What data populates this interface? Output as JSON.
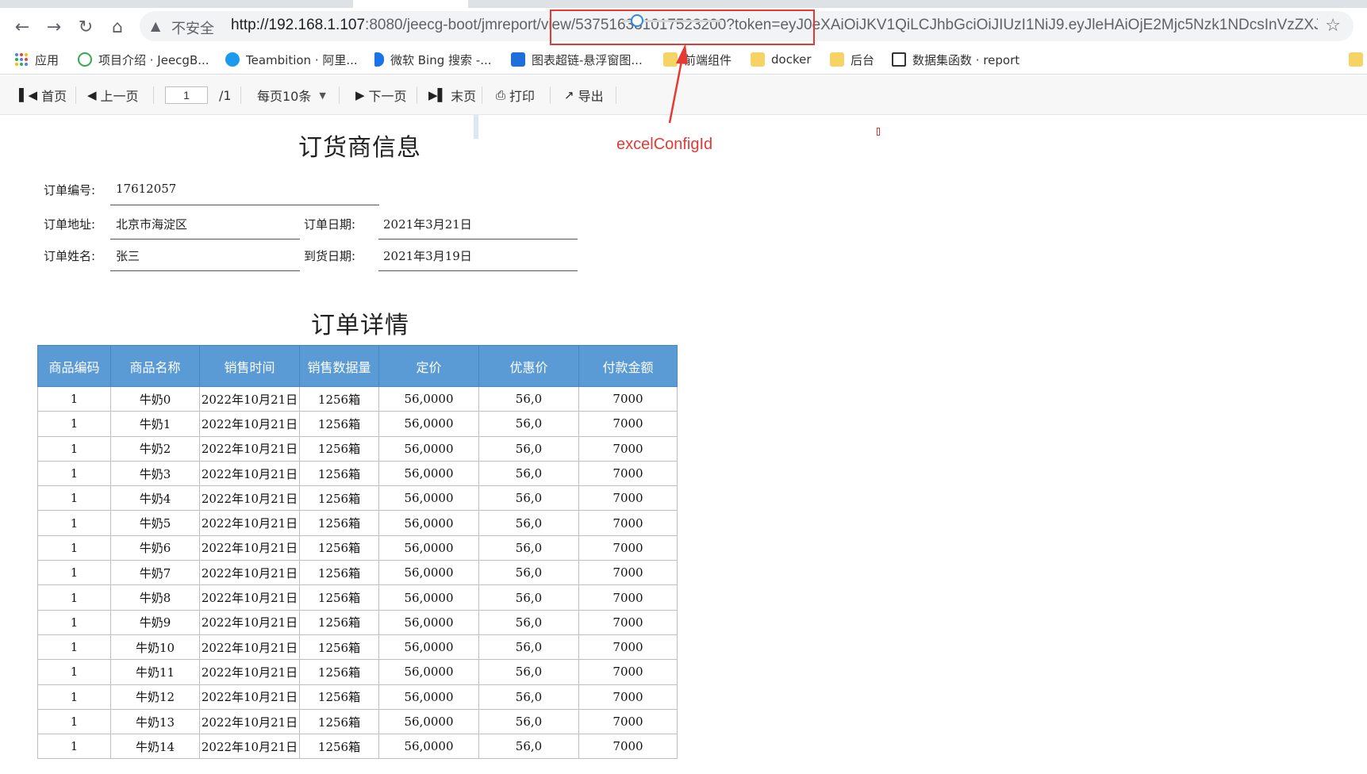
{
  "browser": {
    "insecure_label": "不安全",
    "url_host": "http://192.168.1.107",
    "url_rest": ":8080/jeecg-boot/jmreport/view/537516331017523200?token=eyJ0eXAiOiJKV1QiLCJhbGciOiJIUzI1NiJ9.eyJleHAiOjE2Mjc5Nzk1NDcsInVzZXJ...",
    "bookmarks": [
      {
        "label": "应用",
        "icon": "apps-grid-icon"
      },
      {
        "label": "项目介绍 · JeecgB...",
        "icon": "jeecg-icon"
      },
      {
        "label": "Teambition · 阿里...",
        "icon": "teambition-icon"
      },
      {
        "label": "微软 Bing 搜索 -...",
        "icon": "bing-icon"
      },
      {
        "label": "图表超链-悬浮窗图...",
        "icon": "fanruan-icon"
      },
      {
        "label": "前端组件",
        "icon": "folder-icon"
      },
      {
        "label": "docker",
        "icon": "folder-icon"
      },
      {
        "label": "后台",
        "icon": "folder-icon"
      },
      {
        "label": "数据集函数 · report",
        "icon": "book-icon"
      }
    ]
  },
  "toolbar": {
    "first": "首页",
    "prev": "上一页",
    "page_value": "1",
    "page_total": "/1",
    "page_size": "每页10条",
    "next": "下一页",
    "last": "末页",
    "print": "打印",
    "export": "导出",
    "zoom": 0.1
  },
  "annotation": {
    "label": "excelConfigId",
    "color": "#e53935"
  },
  "report": {
    "supplier_title": "订货商信息",
    "order_no_label": "订单编号:",
    "order_no": "17612057",
    "address_label": "订单地址:",
    "address": "北京市海淀区",
    "order_date_label": "订单日期:",
    "order_date": "2021年3月21日",
    "name_label": "订单姓名:",
    "name": "张三",
    "arrival_label": "到货日期:",
    "arrival_date": "2021年3月19日",
    "detail_title": "订单详情",
    "header_color": "#5b9bd5",
    "columns": [
      "商品编码",
      "商品名称",
      "销售时间",
      "销售数据量",
      "定价",
      "优惠价",
      "付款金额"
    ],
    "rows": [
      [
        "1",
        "牛奶0",
        "2022年10月21日",
        "1256箱",
        "56,0000",
        "56,0",
        "7000"
      ],
      [
        "1",
        "牛奶1",
        "2022年10月21日",
        "1256箱",
        "56,0000",
        "56,0",
        "7000"
      ],
      [
        "1",
        "牛奶2",
        "2022年10月21日",
        "1256箱",
        "56,0000",
        "56,0",
        "7000"
      ],
      [
        "1",
        "牛奶3",
        "2022年10月21日",
        "1256箱",
        "56,0000",
        "56,0",
        "7000"
      ],
      [
        "1",
        "牛奶4",
        "2022年10月21日",
        "1256箱",
        "56,0000",
        "56,0",
        "7000"
      ],
      [
        "1",
        "牛奶5",
        "2022年10月21日",
        "1256箱",
        "56,0000",
        "56,0",
        "7000"
      ],
      [
        "1",
        "牛奶6",
        "2022年10月21日",
        "1256箱",
        "56,0000",
        "56,0",
        "7000"
      ],
      [
        "1",
        "牛奶7",
        "2022年10月21日",
        "1256箱",
        "56,0000",
        "56,0",
        "7000"
      ],
      [
        "1",
        "牛奶8",
        "2022年10月21日",
        "1256箱",
        "56,0000",
        "56,0",
        "7000"
      ],
      [
        "1",
        "牛奶9",
        "2022年10月21日",
        "1256箱",
        "56,0000",
        "56,0",
        "7000"
      ],
      [
        "1",
        "牛奶10",
        "2022年10月21日",
        "1256箱",
        "56,0000",
        "56,0",
        "7000"
      ],
      [
        "1",
        "牛奶11",
        "2022年10月21日",
        "1256箱",
        "56,0000",
        "56,0",
        "7000"
      ],
      [
        "1",
        "牛奶12",
        "2022年10月21日",
        "1256箱",
        "56,0000",
        "56,0",
        "7000"
      ],
      [
        "1",
        "牛奶13",
        "2022年10月21日",
        "1256箱",
        "56,0000",
        "56,0",
        "7000"
      ],
      [
        "1",
        "牛奶14",
        "2022年10月21日",
        "1256箱",
        "56,0000",
        "56,0",
        "7000"
      ]
    ]
  }
}
